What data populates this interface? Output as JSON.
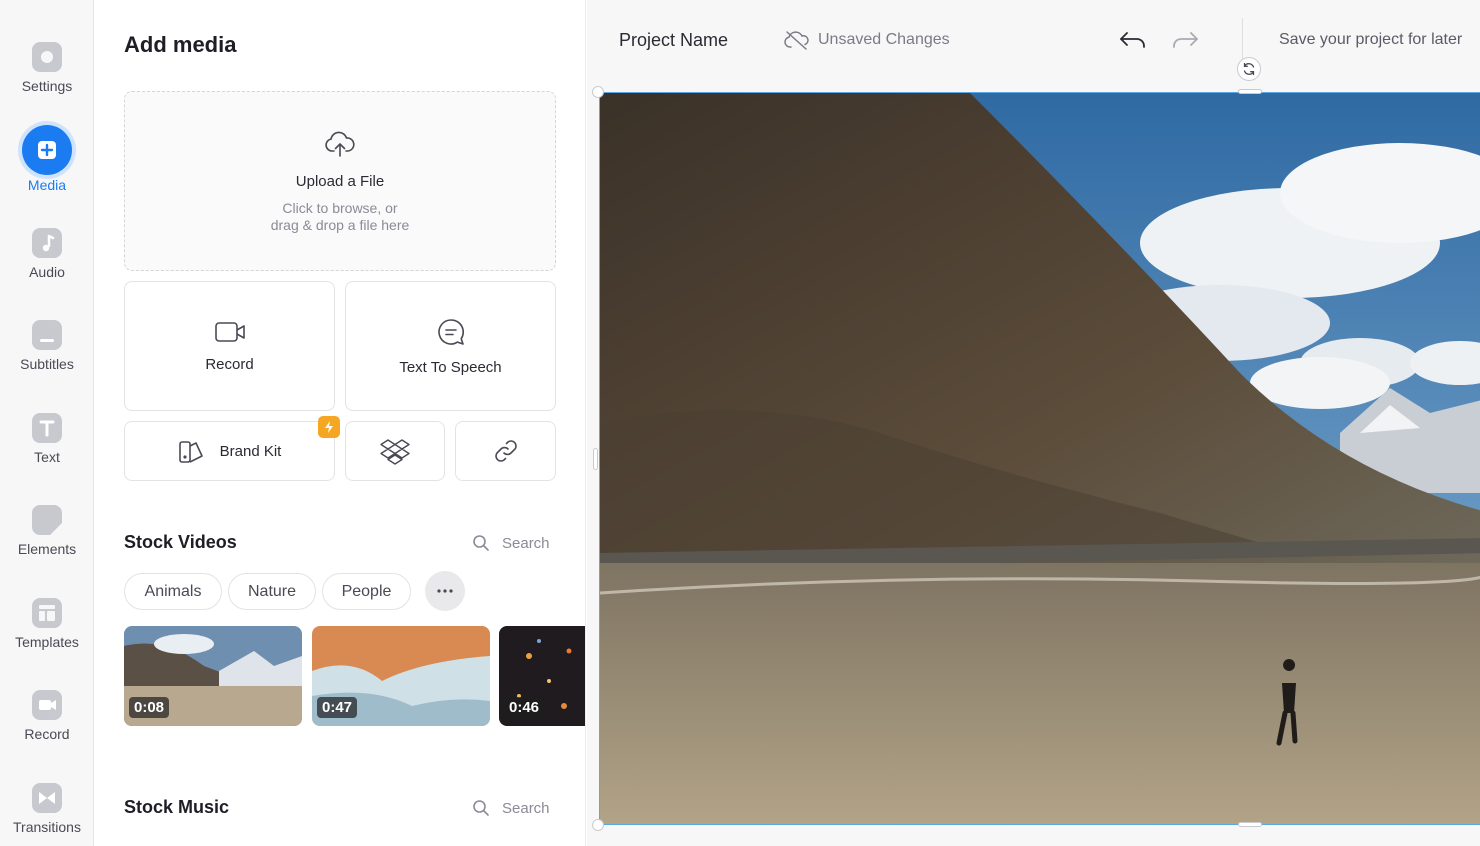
{
  "rail": {
    "items": [
      {
        "label": "Settings",
        "icon": "gear-icon"
      },
      {
        "label": "Media",
        "icon": "plus-icon"
      },
      {
        "label": "Audio",
        "icon": "music-note-icon"
      },
      {
        "label": "Subtitles",
        "icon": "subtitles-icon"
      },
      {
        "label": "Text",
        "icon": "text-t-icon"
      },
      {
        "label": "Elements",
        "icon": "shapes-icon"
      },
      {
        "label": "Templates",
        "icon": "templates-icon"
      },
      {
        "label": "Record",
        "icon": "camera-icon"
      },
      {
        "label": "Transitions",
        "icon": "transition-icon"
      }
    ],
    "active": "Media",
    "accent": "#1b7cf2"
  },
  "panel": {
    "title": "Add media",
    "upload": {
      "title": "Upload a File",
      "hint": "Click to browse, or\ndrag & drop a file here"
    },
    "record_label": "Record",
    "tts_label": "Text To Speech",
    "brand_kit_label": "Brand Kit",
    "brand_kit_badge": "lightning-icon",
    "dropbox_icon": "dropbox-icon",
    "link_icon": "link-icon"
  },
  "stock_videos": {
    "title": "Stock Videos",
    "search_label": "Search",
    "chips": [
      "Animals",
      "Nature",
      "People"
    ],
    "more_icon": "more-dots-icon",
    "thumbs": [
      {
        "duration": "0:08"
      },
      {
        "duration": "0:47"
      },
      {
        "duration": "0:46"
      }
    ]
  },
  "stock_music": {
    "title": "Stock Music",
    "search_label": "Search"
  },
  "topbar": {
    "project_name": "Project Name",
    "status": "Unsaved Changes",
    "save_hint": "Save your project for later"
  },
  "colors": {
    "selection": "#5aa7e6",
    "badge": "#f5a623"
  }
}
